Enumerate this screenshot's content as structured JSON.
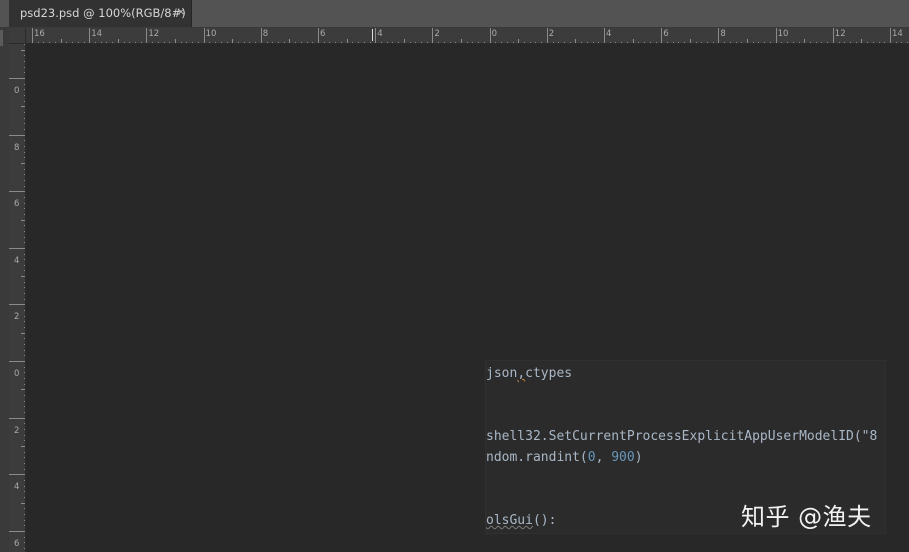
{
  "document_tab": {
    "title": "psd23.psd @ 100%(RGB/8#)",
    "close_glyph": "×"
  },
  "horizontal_ruler": {
    "labels": [
      "16",
      "14",
      "12",
      "10",
      "8",
      "6",
      "4",
      "2",
      "0",
      "2",
      "4",
      "6",
      "8",
      "10",
      "12",
      "14"
    ]
  },
  "vertical_ruler": {
    "labels": [
      "0",
      "8",
      "6",
      "4",
      "2",
      "0",
      "2",
      "4",
      "6"
    ]
  },
  "code_overlay": {
    "line1": {
      "a": "json",
      "b": ",",
      "c": "ctypes"
    },
    "line2": {
      "a": "shell32.SetCurrentProcessExplicitAppUserModelID(\"8"
    },
    "line3": {
      "a": "ndom.randint(",
      "n1": "0",
      "sep": ", ",
      "n2": "900",
      "end": ")"
    },
    "line4": {
      "a": "olsGui",
      "b": "():"
    }
  },
  "watermark": {
    "text": "知乎 @渔夫"
  },
  "colors": {
    "canvas": "#282828",
    "ruler": "#3c3c3c",
    "tabbar": "#535353",
    "code_text": "#a9b7c6",
    "code_number": "#6897bb"
  }
}
